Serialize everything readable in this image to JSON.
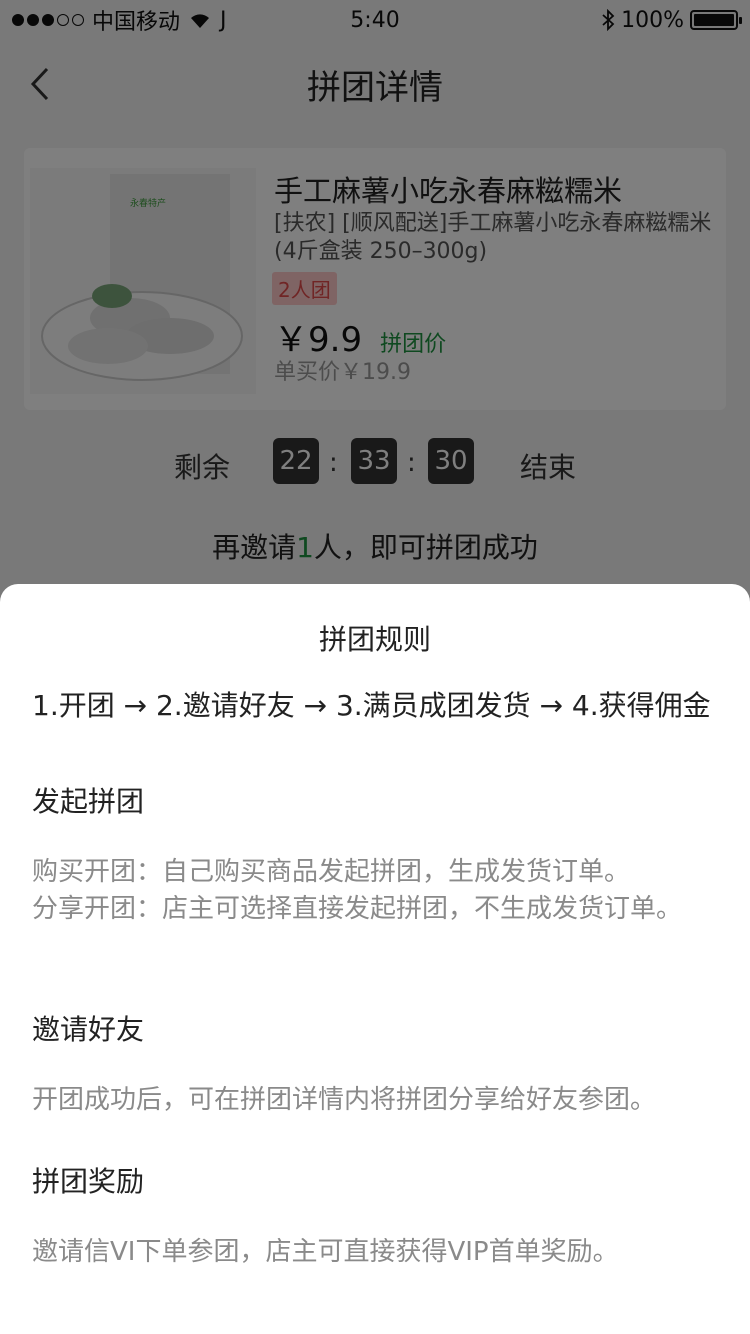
{
  "status_bar": {
    "carrier": "中国移动",
    "extra": "J",
    "time": "5:40",
    "battery_text": "100%",
    "battery_level": 1.0
  },
  "nav": {
    "title": "拼团详情",
    "back_icon": "chevron-left-icon"
  },
  "product": {
    "title": "手工麻薯小吃永春麻糍糯米",
    "description_line1": "[扶农] [顺风配送]手工麻薯小吃永春麻糍糯米",
    "description_line2": "(4斤盒装 250–300g)",
    "group_badge": "2人团",
    "price": "￥9.9",
    "price_label": "拼团价",
    "original_price": "单买价￥19.9",
    "image_brand_text": "永春特产"
  },
  "countdown": {
    "prefix": "剩余",
    "hours": "22",
    "minutes": "33",
    "seconds": "30",
    "separator": ":",
    "suffix": "结束"
  },
  "invite": {
    "before": "再邀请",
    "count": "1",
    "after": "人，即可拼团成功"
  },
  "rules_sheet": {
    "title": "拼团规则",
    "steps": "1.开团 → 2.邀请好友 → 3.满员成团发货 → 4.获得佣金",
    "sections": [
      {
        "title": "发起拼团",
        "lines": [
          "购买开团：自己购买商品发起拼团，生成发货订单。",
          "分享开团：店主可选择直接发起拼团，不生成发货订单。"
        ]
      },
      {
        "title": "邀请好友",
        "lines": [
          "开团成功后，可在拼团详情内将拼团分享给好友参团。"
        ]
      },
      {
        "title": "拼团奖励",
        "lines": [
          "邀请信VI下单参团，店主可直接获得VIP首单奖励。"
        ]
      }
    ]
  },
  "colors": {
    "accent_green": "#1f9340",
    "badge_bg": "#ffc9c9",
    "badge_text": "#e14b4b"
  }
}
